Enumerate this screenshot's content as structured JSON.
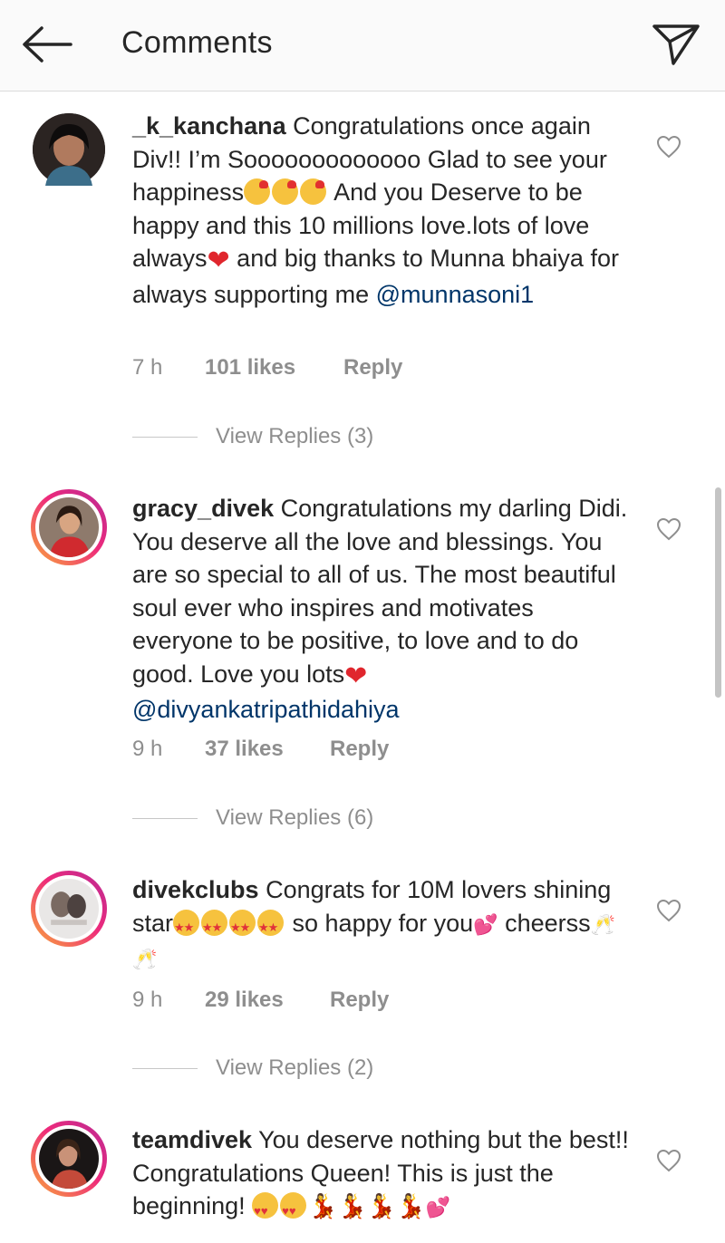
{
  "header": {
    "title": "Comments"
  },
  "comments": [
    {
      "username": "_k_kanchana",
      "text1": " Congratulations once again Div!! I’m Sooooooooooooo Glad to see your happiness",
      "text2": " And you Deserve to be happy and this 10 millions love.lots of love always",
      "text3": " and big thanks to Munna bhaiya for always supporting me ",
      "mention": "@munnasoni1",
      "time": "7 h",
      "likes": "101 likes",
      "reply": "Reply",
      "view_replies": "View Replies (3)"
    },
    {
      "username": "gracy_divek",
      "text1": " Congratulations my darling Didi. You deserve all the love and blessings. You are so special to all of us. The most beautiful soul ever who inspires and motivates everyone to be positive, to love and to do good. Love you lots",
      "text2": " ",
      "mention": "@divyankatripathidahiya",
      "time": "9 h",
      "likes": "37 likes",
      "reply": "Reply",
      "view_replies": "View Replies (6)"
    },
    {
      "username": "divekclubs",
      "text1": " Congrats for 10M lovers shining star",
      "text2": " so happy for you",
      "text3": " cheerss",
      "time": "9 h",
      "likes": "29 likes",
      "reply": "Reply",
      "view_replies": "View Replies (2)"
    },
    {
      "username": "teamdivek",
      "text1": " You deserve nothing but the best!! Congratulations Queen! This is just the beginning! "
    }
  ]
}
